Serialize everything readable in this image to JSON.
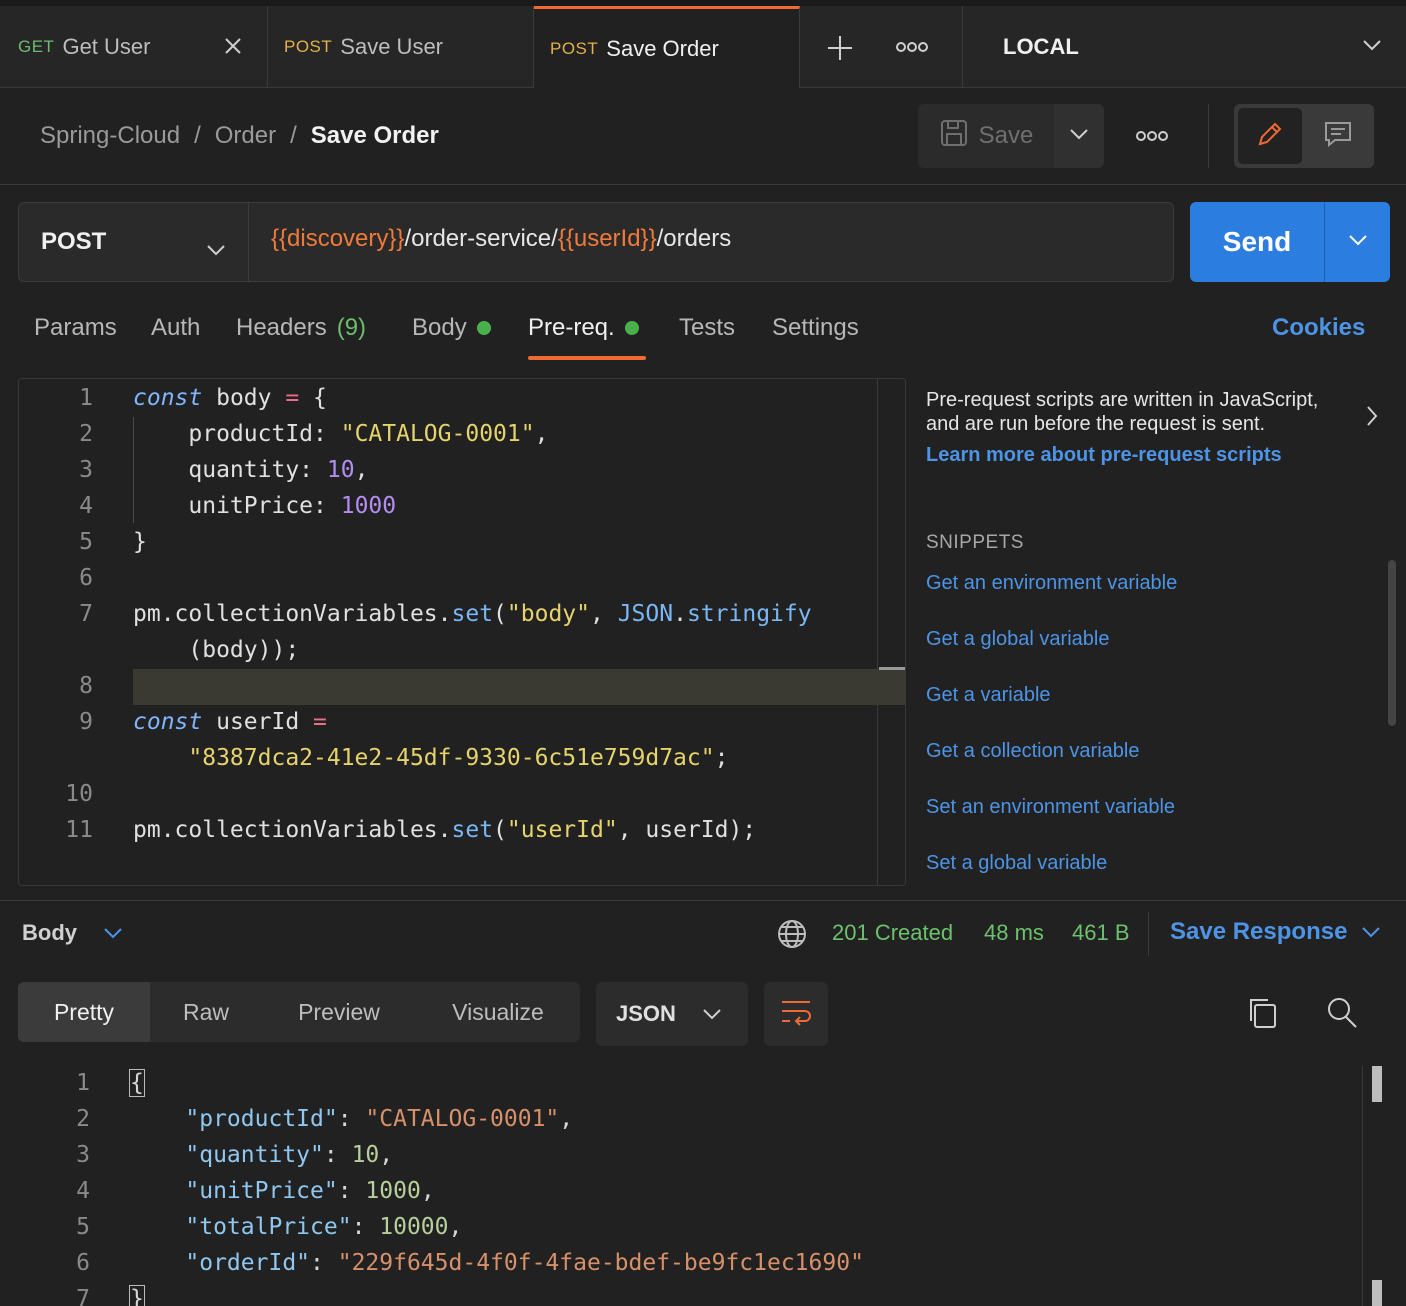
{
  "tabs": [
    {
      "method": "GET",
      "name": "Get User"
    },
    {
      "method": "POST",
      "name": "Save User"
    },
    {
      "method": "POST",
      "name": "Save Order"
    }
  ],
  "environment": "LOCAL",
  "breadcrumb": {
    "collection": "Spring-Cloud",
    "folder": "Order",
    "request": "Save Order",
    "separator": "/"
  },
  "toolbar": {
    "save_label": "Save"
  },
  "request": {
    "method": "POST",
    "url_parts": [
      {
        "text": "{{discovery}}",
        "var": true
      },
      {
        "text": "/order-service/",
        "var": false
      },
      {
        "text": "{{userId}}",
        "var": true
      },
      {
        "text": "/orders",
        "var": false
      }
    ],
    "send_label": "Send"
  },
  "request_tabs": {
    "params": "Params",
    "auth": "Auth",
    "headers": "Headers",
    "headers_count": "(9)",
    "body": "Body",
    "prereq": "Pre-req.",
    "tests": "Tests",
    "settings": "Settings",
    "cookies": "Cookies"
  },
  "editor": {
    "line_numbers": [
      "1",
      "2",
      "3",
      "4",
      "5",
      "6",
      "7",
      "8",
      "9",
      "10",
      "11"
    ]
  },
  "side_panel": {
    "description": "Pre-request scripts are written in JavaScript, and are run before the request is sent.",
    "learn_more": "Learn more about pre-request scripts",
    "snippets_title": "SNIPPETS",
    "snippets": [
      "Get an environment variable",
      "Get a global variable",
      "Get a variable",
      "Get a collection variable",
      "Set an environment variable",
      "Set a global variable"
    ]
  },
  "response": {
    "body_selector": "Body",
    "status": "201 Created",
    "time": "48 ms",
    "size": "461 B",
    "save_response": "Save Response",
    "views": [
      "Pretty",
      "Raw",
      "Preview",
      "Visualize"
    ],
    "format": "JSON",
    "line_numbers": [
      "1",
      "2",
      "3",
      "4",
      "5",
      "6",
      "7"
    ]
  },
  "colors": {
    "accent": "#ef6a34",
    "send": "#2c7de0",
    "link": "#4d94e6",
    "success": "#6cc26c"
  }
}
